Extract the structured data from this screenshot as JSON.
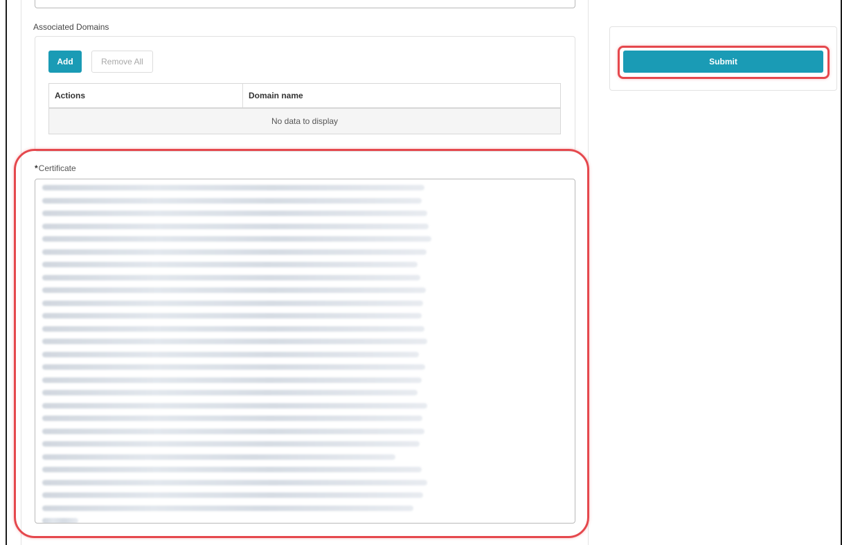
{
  "form": {
    "associated_domains_label": "Associated Domains",
    "add_label": "Add",
    "remove_all_label": "Remove All",
    "table": {
      "columns": [
        "Actions",
        "Domain name"
      ],
      "empty_text": "No data to display"
    },
    "certificate": {
      "required_mark": "*",
      "label": "Certificate",
      "value_obscured": true
    }
  },
  "sidebar": {
    "submit_label": "Submit"
  },
  "colors": {
    "accent": "#1a9bb5",
    "highlight": "#e5484d"
  }
}
